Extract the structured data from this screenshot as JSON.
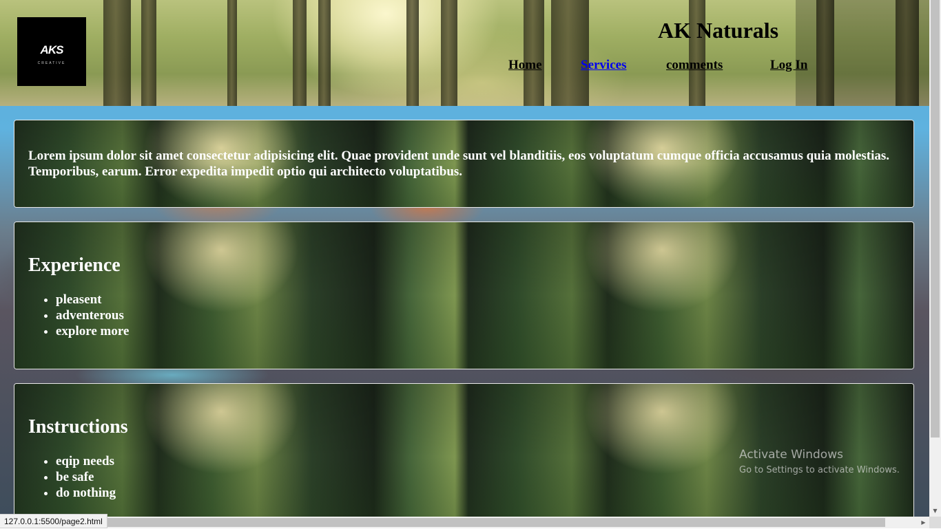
{
  "header": {
    "logo": {
      "main": "AKS",
      "sub": "CREATIVE"
    },
    "title": "AK Naturals",
    "nav": [
      {
        "label": "Home"
      },
      {
        "label": "Services"
      },
      {
        "label": "comments"
      },
      {
        "label": "Log In"
      }
    ],
    "active_nav": "Services"
  },
  "main": {
    "intro": {
      "text": "Lorem ipsum dolor sit amet consectetur adipisicing elit. Quae provident unde sunt vel blanditiis, eos voluptatum cumque officia accusamus quia molestias. Temporibus, earum. Error expedita impedit optio qui architecto voluptatibus."
    },
    "experience": {
      "heading": "Experience",
      "items": [
        "pleasent",
        "adventerous",
        "explore more"
      ]
    },
    "instructions": {
      "heading": "Instructions",
      "items": [
        "eqip needs",
        "be safe",
        "do nothing"
      ]
    }
  },
  "watermark": {
    "title": "Activate Windows",
    "subtitle": "Go to Settings to activate Windows."
  },
  "status_bar": {
    "url": "127.0.0.1:5500/page2.html"
  },
  "colors": {
    "nav_active": "#0000ee",
    "nav_default": "#000000",
    "card_text": "#ffffff",
    "card_border": "#e8e8e8"
  }
}
